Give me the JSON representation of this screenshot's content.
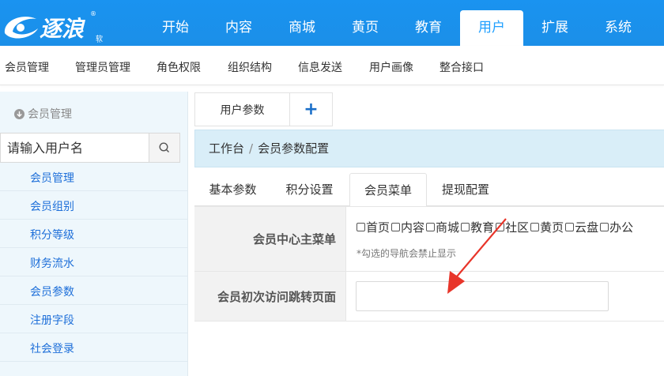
{
  "logo": {
    "text": "逐浪",
    "small_text": "软件",
    "mark": "®"
  },
  "nav": {
    "items": [
      {
        "label": "开始",
        "active": false
      },
      {
        "label": "内容",
        "active": false
      },
      {
        "label": "商城",
        "active": false
      },
      {
        "label": "黄页",
        "active": false
      },
      {
        "label": "教育",
        "active": false
      },
      {
        "label": "用户",
        "active": true
      },
      {
        "label": "扩展",
        "active": false
      },
      {
        "label": "系统",
        "active": false
      }
    ]
  },
  "subnav": {
    "items": [
      "会员管理",
      "管理员管理",
      "角色权限",
      "组织结构",
      "信息发送",
      "用户画像",
      "整合接口"
    ]
  },
  "sidebar": {
    "title": "会员管理",
    "search_placeholder": "请输入用户名",
    "items": [
      "会员管理",
      "会员组别",
      "积分等级",
      "财务流水",
      "会员参数",
      "注册字段",
      "社会登录"
    ]
  },
  "page_tabs": {
    "current": "用户参数",
    "add": "+"
  },
  "breadcrumb": {
    "home": "工作台",
    "separator": "/",
    "current": "会员参数配置"
  },
  "content_tabs": [
    {
      "label": "基本参数",
      "active": false
    },
    {
      "label": "积分设置",
      "active": false
    },
    {
      "label": "会员菜单",
      "active": true
    },
    {
      "label": "提现配置",
      "active": false
    }
  ],
  "form": {
    "menu_label": "会员中心主菜单",
    "menu_options": [
      "首页",
      "内容",
      "商城",
      "教育",
      "社区",
      "黄页",
      "云盘",
      "办公"
    ],
    "menu_hint": "*勾选的导航会禁止显示",
    "redirect_label": "会员初次访问跳转页面",
    "redirect_value": ""
  },
  "colors": {
    "brand": "#1E9FFF",
    "annotation": "#E8352A"
  }
}
